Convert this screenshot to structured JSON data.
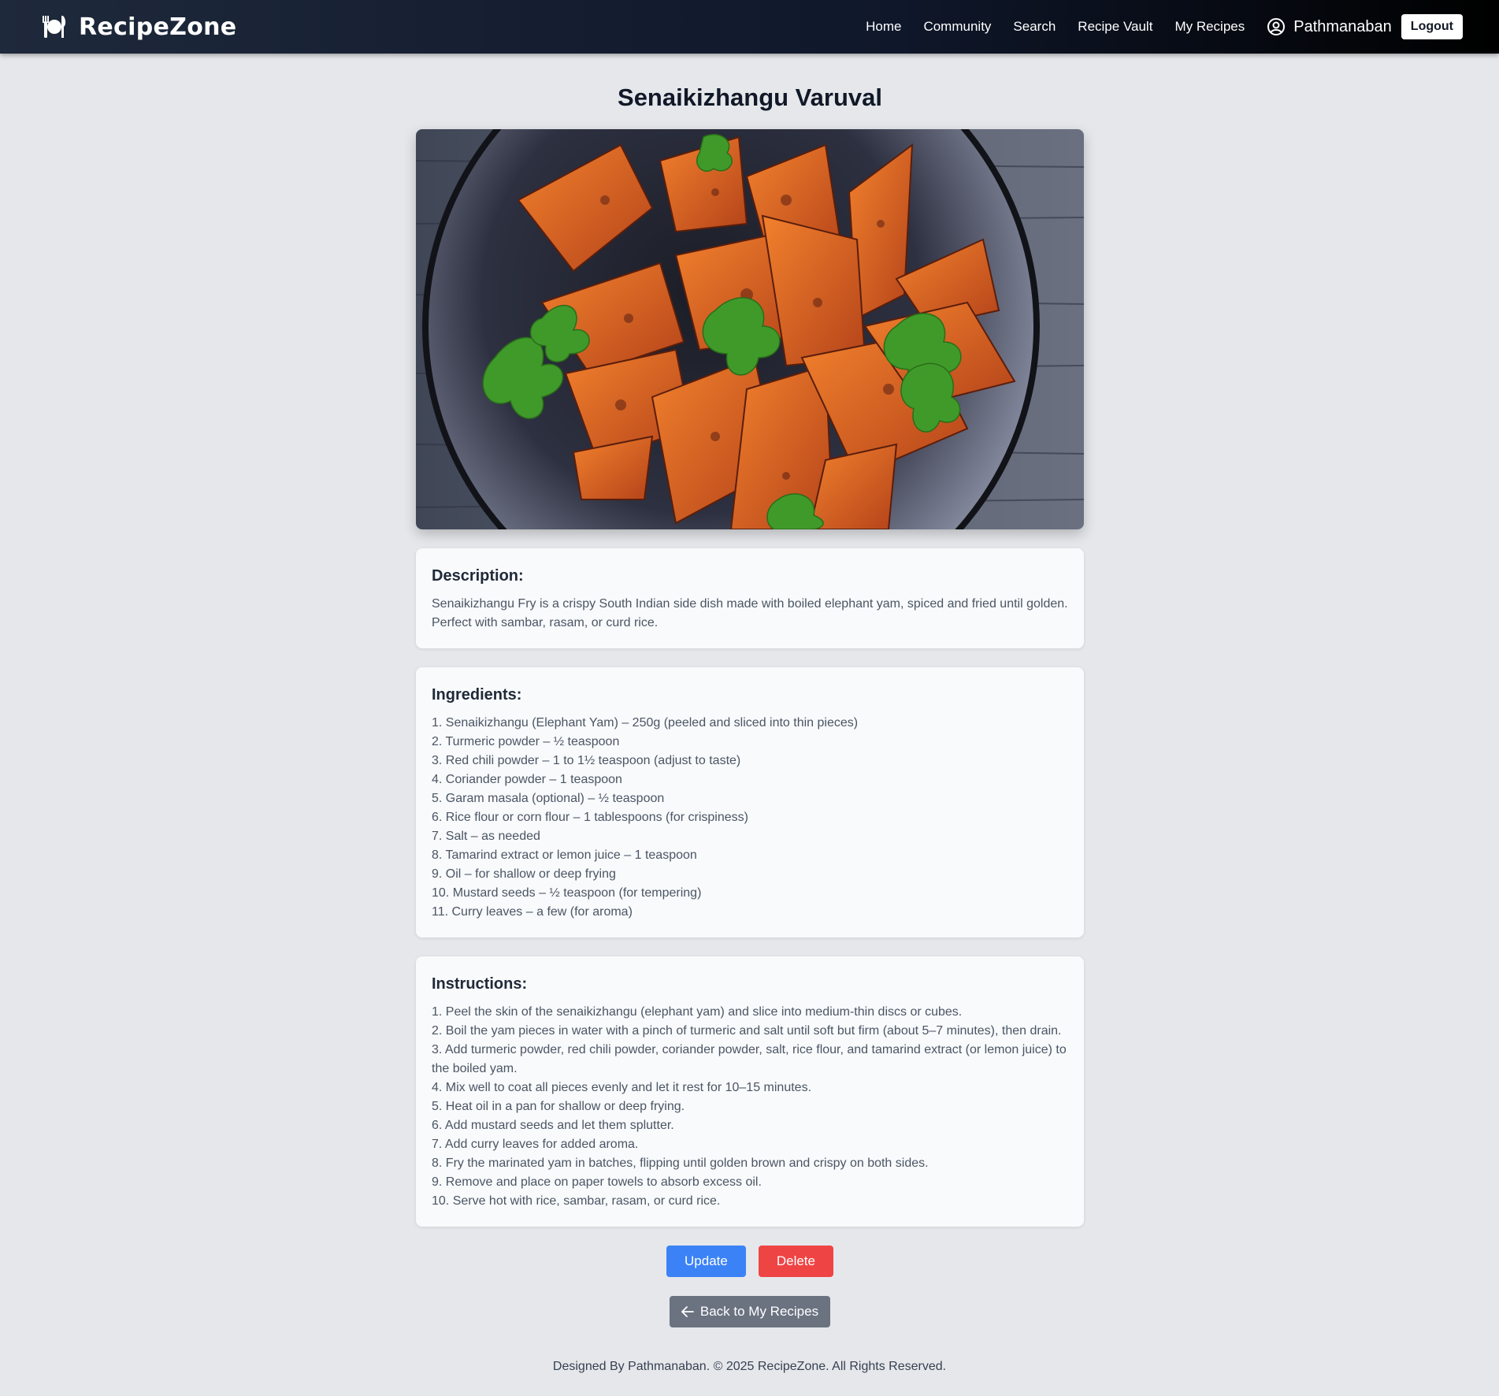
{
  "navbar": {
    "brand": "RecipeZone",
    "brand_icon": "plate-cutlery-icon",
    "links": [
      "Home",
      "Community",
      "Search",
      "Recipe Vault",
      "My Recipes"
    ],
    "user_icon": "user-circle-icon",
    "username": "Pathmanaban",
    "logout_label": "Logout"
  },
  "recipe": {
    "title": "Senaikizhangu Varuval",
    "image_alt": "Roasted elephant yam pieces garnished with parsley on a dark plate",
    "description_heading": "Description:",
    "description": "Senaikizhangu Fry is a crispy South Indian side dish made with boiled elephant yam, spiced and fried until golden. Perfect with sambar, rasam, or curd rice.",
    "ingredients_heading": "Ingredients:",
    "ingredients": [
      "1. Senaikizhangu (Elephant Yam) – 250g (peeled and sliced into thin pieces)",
      "2. Turmeric powder – ½ teaspoon",
      "3. Red chili powder – 1 to 1½ teaspoon (adjust to taste)",
      "4. Coriander powder – 1 teaspoon",
      "5. Garam masala (optional) – ½ teaspoon",
      "6. Rice flour or corn flour – 1 tablespoons (for crispiness)",
      "7. Salt – as needed",
      "8. Tamarind extract or lemon juice – 1 teaspoon",
      "9. Oil – for shallow or deep frying",
      "10. Mustard seeds – ½ teaspoon (for tempering)",
      "11. Curry leaves – a few (for aroma)"
    ],
    "instructions_heading": "Instructions:",
    "instructions": [
      "1. Peel the skin of the senaikizhangu (elephant yam) and slice into medium-thin discs or cubes.",
      "2. Boil the yam pieces in water with a pinch of turmeric and salt until soft but firm (about 5–7 minutes), then drain.",
      "3. Add turmeric powder, red chili powder, coriander powder, salt, rice flour, and tamarind extract (or lemon juice) to the boiled yam.",
      "4. Mix well to coat all pieces evenly and let it rest for 10–15 minutes.",
      "5. Heat oil in a pan for shallow or deep frying.",
      "6. Add mustard seeds and let them splutter.",
      "7. Add curry leaves for added aroma.",
      "8. Fry the marinated yam in batches, flipping until golden brown and crispy on both sides.",
      "9. Remove and place on paper towels to absorb excess oil.",
      "10. Serve hot with rice, sambar, rasam, or curd rice."
    ]
  },
  "actions": {
    "update_label": "Update",
    "delete_label": "Delete",
    "back_label": "Back to My Recipes",
    "back_icon": "arrow-left-icon"
  },
  "footer": {
    "text": "Designed By Pathmanaban. © 2025 RecipeZone. All Rights Reserved."
  },
  "colors": {
    "navbar_start": "#1e293b",
    "navbar_end": "#000000",
    "page_bg": "#e5e7eb",
    "card_bg": "#f8fafc",
    "update": "#3b82f6",
    "delete": "#ef4444",
    "back": "#6b7280"
  }
}
